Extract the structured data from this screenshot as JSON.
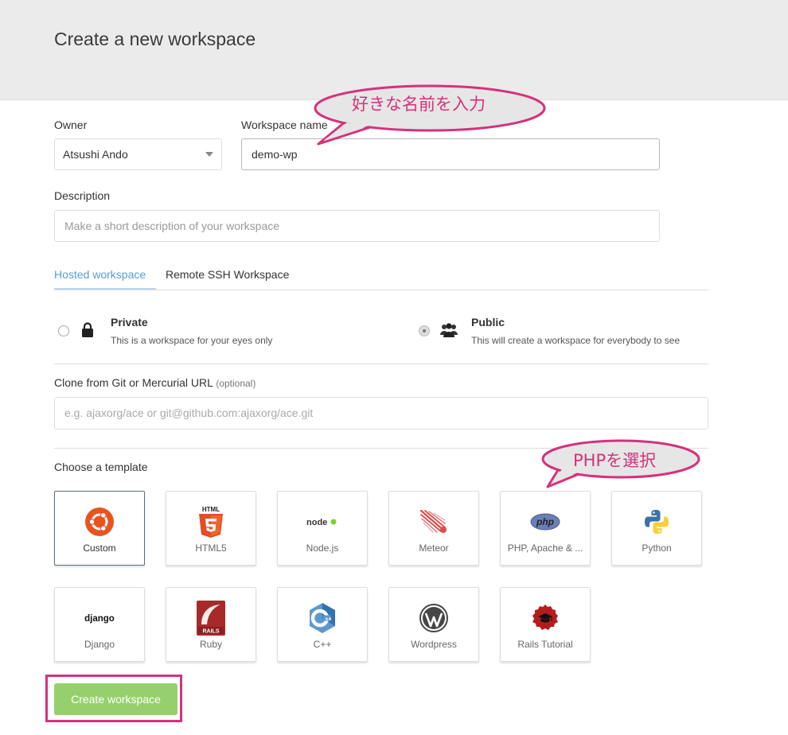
{
  "header": {
    "title": "Create a new workspace"
  },
  "form": {
    "owner_label": "Owner",
    "owner_value": "Atsushi Ando",
    "workspace_name_label": "Workspace name",
    "workspace_name_value": "demo-wp",
    "description_label": "Description",
    "description_placeholder": "Make a short description of your workspace"
  },
  "tabs": [
    {
      "label": "Hosted workspace",
      "active": true
    },
    {
      "label": "Remote SSH Workspace",
      "active": false
    }
  ],
  "visibility": {
    "private": {
      "title": "Private",
      "description": "This is a workspace for your eyes only",
      "selected": false
    },
    "public": {
      "title": "Public",
      "description": "This will create a workspace for everybody to see",
      "selected": true
    }
  },
  "clone": {
    "label": "Clone from Git or Mercurial URL",
    "optional": "(optional)",
    "placeholder": "e.g. ajaxorg/ace or git@github.com:ajaxorg/ace.git"
  },
  "templates": {
    "heading": "Choose a template",
    "items": [
      {
        "label": "Custom",
        "icon": "ubuntu-icon",
        "selected": true
      },
      {
        "label": "HTML5",
        "icon": "html5-icon",
        "badge": "HTML"
      },
      {
        "label": "Node.js",
        "icon": "nodejs-icon",
        "badge": "node"
      },
      {
        "label": "Meteor",
        "icon": "meteor-icon"
      },
      {
        "label": "PHP, Apache & ...",
        "icon": "php-icon",
        "badge": "php"
      },
      {
        "label": "Python",
        "icon": "python-icon"
      },
      {
        "label": "Django",
        "icon": "django-icon",
        "badge": "django"
      },
      {
        "label": "Ruby",
        "icon": "rails-icon",
        "badge": "RAILS"
      },
      {
        "label": "C++",
        "icon": "cpp-icon"
      },
      {
        "label": "Wordpress",
        "icon": "wordpress-icon"
      },
      {
        "label": "Rails Tutorial",
        "icon": "rails-tutorial-icon"
      }
    ]
  },
  "actions": {
    "create_label": "Create workspace"
  },
  "annotations": {
    "name_callout": "好きな名前を入力",
    "php_callout": "PHPを選択"
  },
  "colors": {
    "accent_pink": "#d6317d",
    "callout_fill": "#e6e6e6",
    "tab_active": "#5b9bd5",
    "button_green": "#96d06c"
  }
}
